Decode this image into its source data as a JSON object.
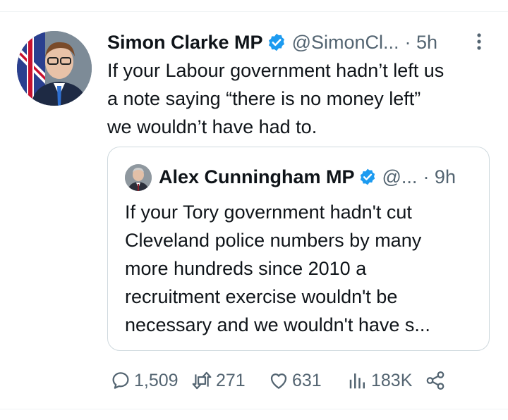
{
  "author": {
    "name": "Simon Clarke MP",
    "handle": "@SimonCl...",
    "time": "· 5h",
    "text": "If your Labour government hadn’t left us\na note saying “there is no money left”\nwe wouldn’t have had to."
  },
  "quoted": {
    "name": "Alex Cunningham MP",
    "handle": "@...",
    "time": "· 9h",
    "text": "If your Tory government hadn't cut\nCleveland police numbers by many\nmore hundreds since 2010 a\nrecruitment exercise wouldn't be\nnecessary and we wouldn't have s..."
  },
  "stats": {
    "replies": "1,509",
    "retweets": "271",
    "likes": "631",
    "views": "183K"
  },
  "colors": {
    "accent": "#1d9bf0",
    "muted": "#536471",
    "border": "#cfd9de"
  },
  "icons": [
    "verified-badge-icon",
    "more-options-icon",
    "reply-icon",
    "retweet-icon",
    "like-icon",
    "views-icon",
    "share-icon"
  ]
}
